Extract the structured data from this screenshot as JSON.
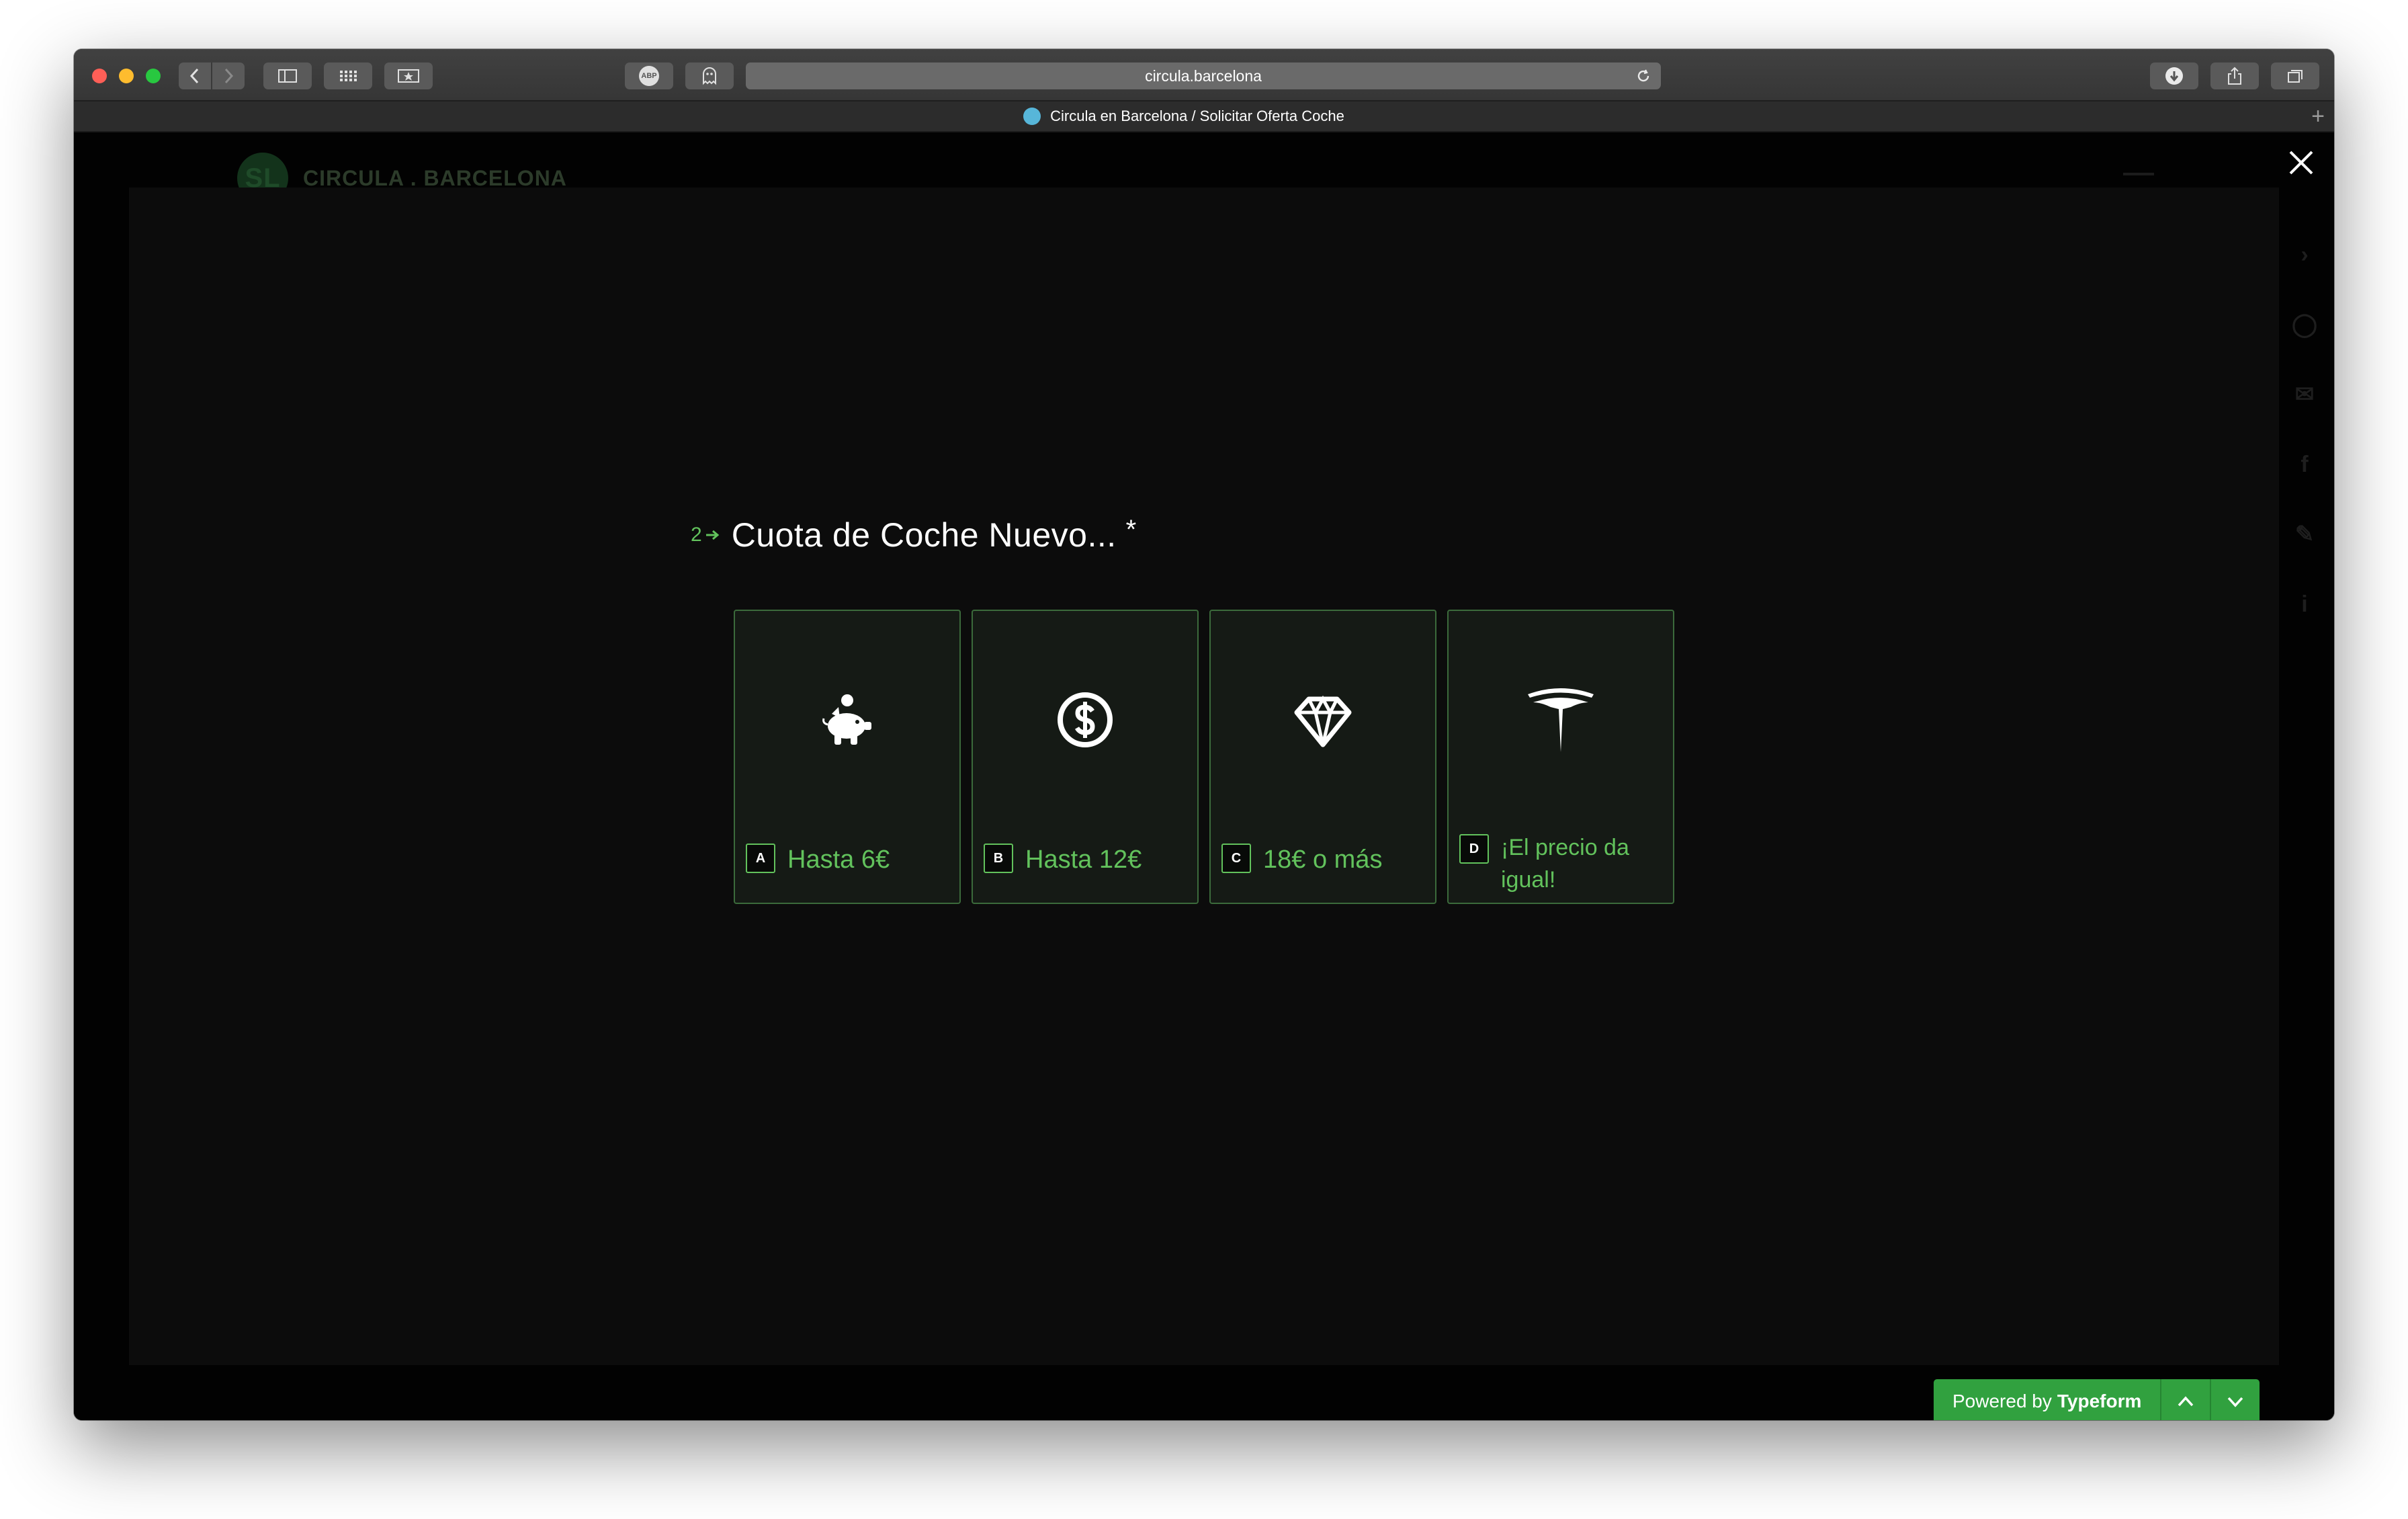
{
  "browser": {
    "url": "circula.barcelona",
    "tab_title": "Circula en Barcelona / Solicitar Oferta Coche",
    "new_tab_label": "+",
    "adblock_label": "ABP"
  },
  "site": {
    "logo_mark": "SL",
    "logo_text": "CIRCULA . BARCELONA"
  },
  "form": {
    "question_number": "2",
    "question_text": "Cuota de Coche Nuevo...",
    "required_mark": "*",
    "choices": [
      {
        "key": "A",
        "label": "Hasta 6€",
        "icon": "piggy-bank-icon"
      },
      {
        "key": "B",
        "label": "Hasta 12€",
        "icon": "dollar-coin-icon"
      },
      {
        "key": "C",
        "label": "18€ o más",
        "icon": "diamond-icon"
      },
      {
        "key": "D",
        "label": "¡El precio da igual!",
        "icon": "tesla-logo-icon"
      }
    ]
  },
  "footer": {
    "powered_prefix": "Powered by",
    "powered_brand": "Typeform"
  },
  "colors": {
    "accent": "#62c25c",
    "choice_background": "#151a15",
    "choice_border": "#3b6a3b",
    "typeform_green": "#31a13f",
    "modal_background": "#0c0c0c"
  }
}
